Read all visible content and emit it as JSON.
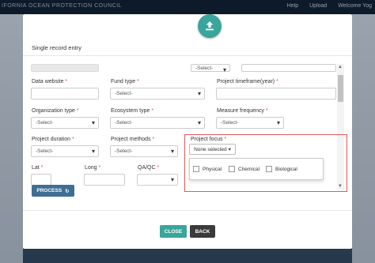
{
  "topbar": {
    "brand": "IFORNIA OCEAN PROTECTION COUNCIL",
    "help": "Help",
    "upload": "Upload",
    "welcome": "Welcome Yog"
  },
  "modal": {
    "title": "Single record entry",
    "partial_row": {
      "select_value": "-Select-"
    },
    "fields": {
      "data_website": {
        "label": "Data website",
        "required": "*"
      },
      "fund_type": {
        "label": "Fund type",
        "required": "*",
        "value": "-Select-"
      },
      "project_timeframe": {
        "label": "Project timeframe(year)",
        "required": "*"
      },
      "organization_type": {
        "label": "Organization type",
        "required": "*",
        "value": "-Select-"
      },
      "ecosystem_type": {
        "label": "Ecosystem type",
        "required": "*",
        "value": "-Select-"
      },
      "measure_frequency": {
        "label": "Measure frequency",
        "required": "*",
        "value": "-Select-"
      },
      "project_duration": {
        "label": "Project duration",
        "required": "*",
        "value": "-Select-"
      },
      "project_methods": {
        "label": "Project methods",
        "required": "*",
        "value": "-Select-"
      },
      "project_focus": {
        "label": "Project focus",
        "required": "*",
        "button": "None selected",
        "options": [
          "Physical",
          "Chemical",
          "Biological"
        ]
      },
      "lat": {
        "label": "Lat",
        "required": "*"
      },
      "long": {
        "label": "Long",
        "required": "*"
      },
      "qaqc": {
        "label": "QA/QC",
        "required": "*"
      }
    },
    "process_button": "PROCESS",
    "close_button": "CLOSE",
    "back_button": "BACK"
  },
  "colors": {
    "teal": "#3aa59a",
    "process_blue": "#3e6e93",
    "required_red": "#d9534f",
    "highlight_red": "#e05a5a"
  },
  "icons": [
    "upload-icon",
    "refresh-icon",
    "caret-down-icon"
  ]
}
